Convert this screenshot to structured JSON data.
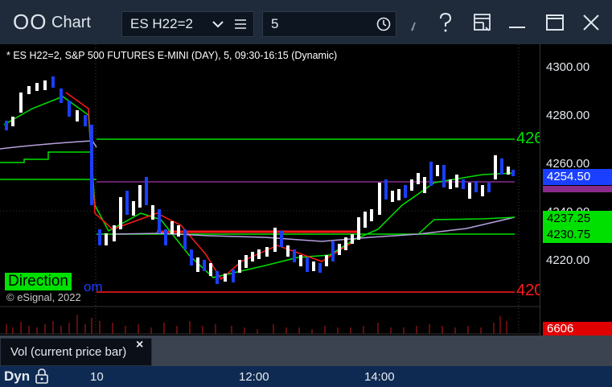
{
  "window": {
    "app_icon": "OO",
    "title": "Chart",
    "symbol": "ES H22=2",
    "interval": "5"
  },
  "chart": {
    "legend": "* ES H22=2, S&P 500 FUTURES E-MINI (DAY), 5, 09:30-16:15 (Dynamic)",
    "direction_label": "Direction",
    "com_text": "om",
    "copyright": "© eSignal, 2022",
    "right_labels": [
      "426",
      "420"
    ]
  },
  "price_axis": {
    "ticks": [
      "4300.00",
      "4280.00",
      "4260.00",
      "4220.00"
    ],
    "hidden_tick": "4240.00",
    "tags": [
      {
        "value": "4254.50",
        "bg": "#1a3fff",
        "color": "#ffffff"
      },
      {
        "value": "4237.25",
        "bg": "#00e000",
        "color": "#000000"
      },
      {
        "value": "4230.75",
        "bg": "#00e000",
        "color": "#000000"
      }
    ],
    "volume_tag": {
      "value": "6606",
      "bg": "#e00000",
      "color": "#ffffff"
    }
  },
  "volume_panel": {
    "popup_label": "Vol (current price bar)",
    "close_glyph": "×"
  },
  "time_axis": {
    "mode": "Dyn",
    "labels": [
      "10",
      "12:00",
      "14:00"
    ]
  },
  "colors": {
    "green_line": "#00e000",
    "red_line": "#ff1a1a",
    "purple_line": "#b7a1e0",
    "up_candle": "#ffffff",
    "down_candle": "#1a3fff"
  },
  "icons": [
    "menu-lines-icon",
    "clock-icon",
    "pencil-icon",
    "help-icon",
    "layout-icon",
    "minimize-icon",
    "maximize-icon",
    "close-icon",
    "lock-icon"
  ]
}
